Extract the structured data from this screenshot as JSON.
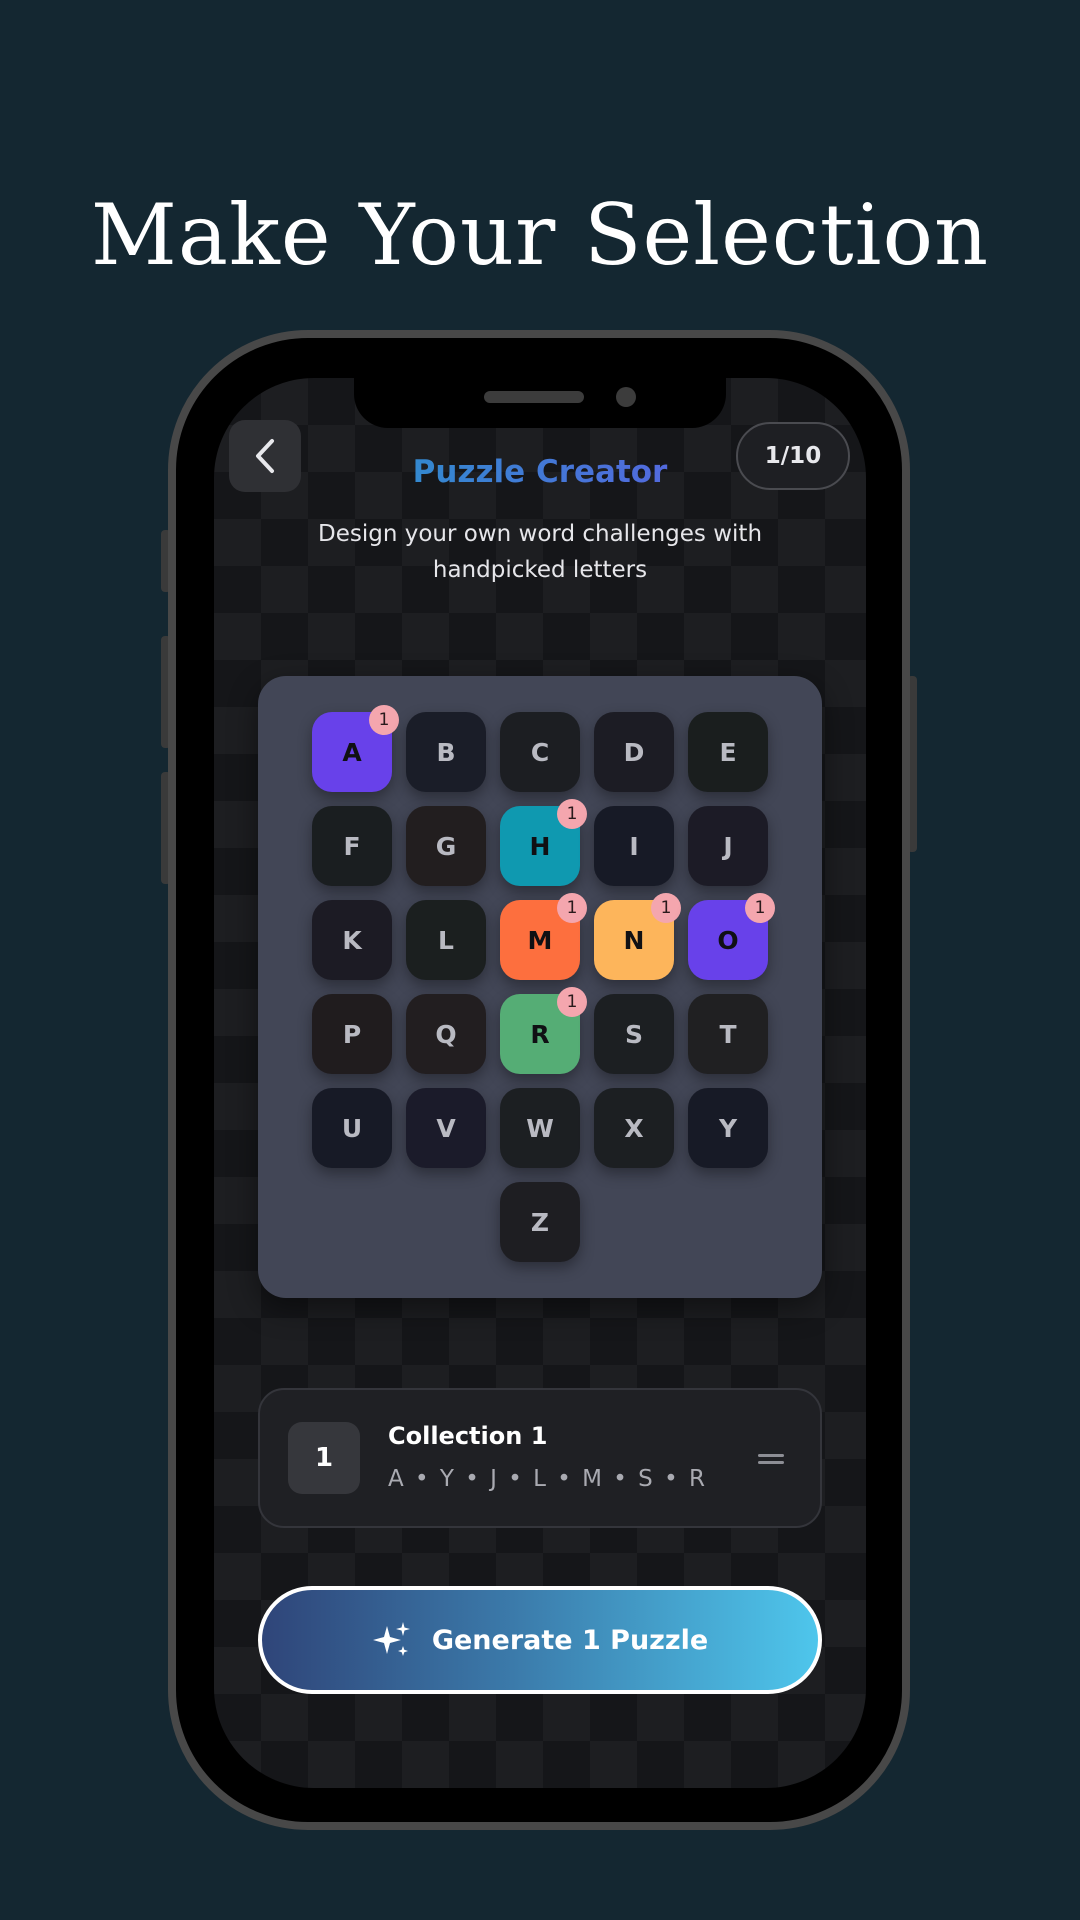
{
  "headline": "Make Your Selection",
  "header": {
    "back_icon": "chevron-left-icon",
    "title": "Puzzle Creator",
    "counter": "1/10",
    "subtitle": "Design your own word challenges with handpicked letters"
  },
  "letters": [
    {
      "letter": "A",
      "count": "1",
      "color": "#6841ea"
    },
    {
      "letter": "B",
      "color": "#1a1d28"
    },
    {
      "letter": "C",
      "color": "#1c1e22"
    },
    {
      "letter": "D",
      "color": "#1c1c24"
    },
    {
      "letter": "E",
      "color": "#1a1e1e"
    },
    {
      "letter": "F",
      "color": "#1a1e20"
    },
    {
      "letter": "G",
      "color": "#221e1f"
    },
    {
      "letter": "H",
      "count": "1",
      "color": "#0f99b0"
    },
    {
      "letter": "I",
      "color": "#171a26"
    },
    {
      "letter": "J",
      "color": "#1c1b26"
    },
    {
      "letter": "K",
      "color": "#1c1b24"
    },
    {
      "letter": "L",
      "color": "#1b1f1f"
    },
    {
      "letter": "M",
      "count": "1",
      "color": "#fd6f3e"
    },
    {
      "letter": "N",
      "count": "1",
      "color": "#fdb55b"
    },
    {
      "letter": "O",
      "count": "1",
      "color": "#6841ea"
    },
    {
      "letter": "P",
      "color": "#201c1e"
    },
    {
      "letter": "Q",
      "color": "#221e20"
    },
    {
      "letter": "R",
      "count": "1",
      "color": "#55ad75"
    },
    {
      "letter": "S",
      "color": "#1c1f22"
    },
    {
      "letter": "T",
      "color": "#202022"
    },
    {
      "letter": "U",
      "color": "#171a26"
    },
    {
      "letter": "V",
      "color": "#1b1b2a"
    },
    {
      "letter": "W",
      "color": "#1c1f22"
    },
    {
      "letter": "X",
      "color": "#1c1f22"
    },
    {
      "letter": "Y",
      "color": "#171a26"
    },
    {
      "letter": "Z",
      "color": "#1e1e22"
    }
  ],
  "collection": {
    "number": "1",
    "name": "Collection 1",
    "letters": "A • Y • J • L • M • S • R",
    "handle_icon": "drag-handle-icon"
  },
  "generate_button": {
    "icon": "sparkles-icon",
    "label": "Generate 1 Puzzle"
  }
}
